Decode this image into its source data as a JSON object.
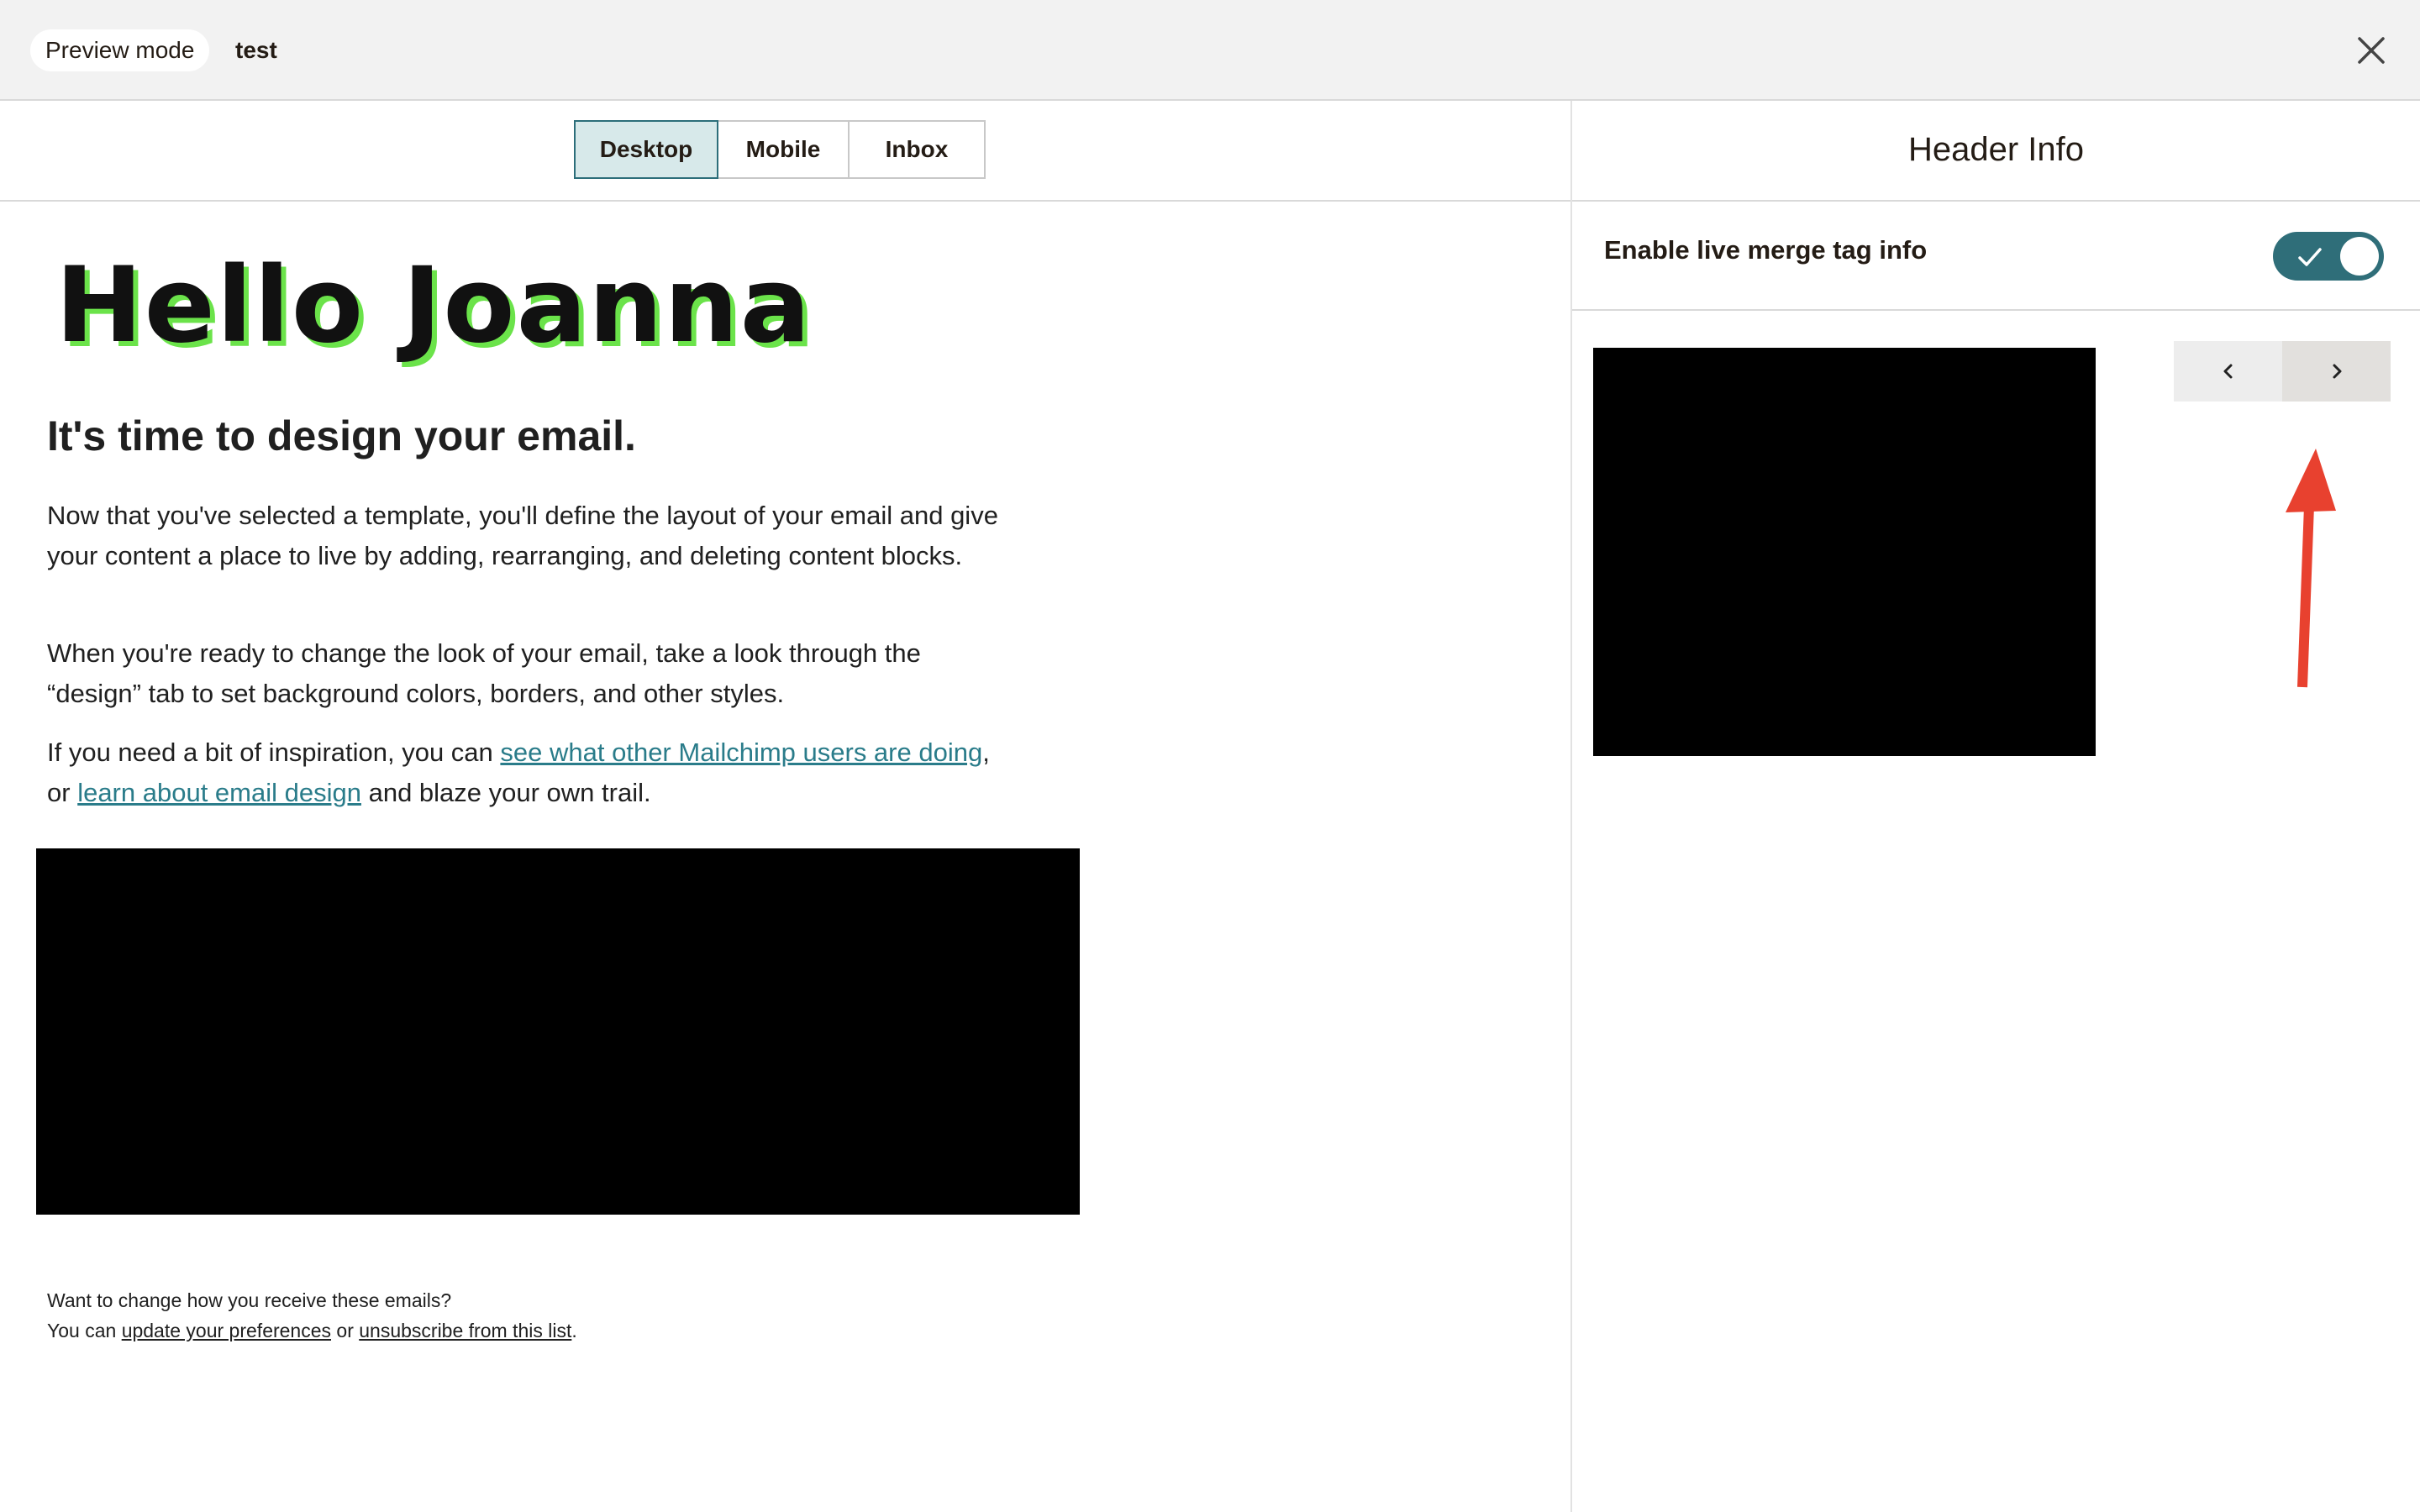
{
  "topbar": {
    "mode_label": "Preview mode",
    "campaign_name": "test",
    "close_icon": "close-icon"
  },
  "tabs": [
    {
      "label": "Desktop",
      "active": true
    },
    {
      "label": "Mobile",
      "active": false
    },
    {
      "label": "Inbox",
      "active": false
    }
  ],
  "email": {
    "hero_title": "Hello Joanna",
    "headline": "It's time to design your email.",
    "p1": "Now that you've selected a template, you'll define the layout of your email and give your content a place to live by adding, rearranging, and deleting content blocks.",
    "p2": "When you're ready to change the look of your email, take a look through the “design” tab to set background colors, borders, and other styles.",
    "p3_prefix": "If you need a bit of inspiration, you can ",
    "p3_link1": "see what other Mailchimp users are doing",
    "p3_mid": ", or ",
    "p3_link2": "learn about email design",
    "p3_suffix": " and blaze your own trail.",
    "footer_line1": "Want to change how you receive these emails?",
    "footer_prefix": "You can ",
    "footer_link1": "update your preferences",
    "footer_mid": " or ",
    "footer_link2": "unsubscribe from this list",
    "footer_suffix": "."
  },
  "panel": {
    "title": "Header Info",
    "merge_label": "Enable live merge tag info",
    "toggle_on": true
  },
  "colors": {
    "accent": "#2f6e79",
    "link": "#2a7c8a",
    "annotation_arrow": "#e8412f",
    "hero_shadow": "#6be34a"
  }
}
